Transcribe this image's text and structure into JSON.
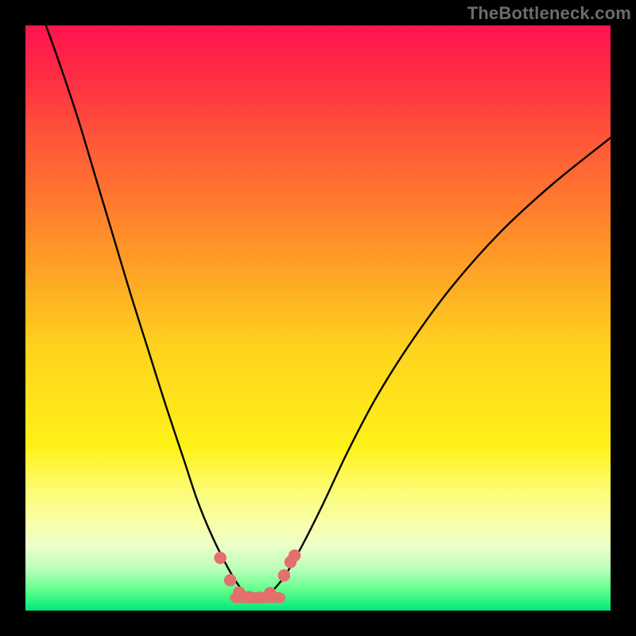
{
  "brand": {
    "watermark": "TheBottleneck.com"
  },
  "colors": {
    "marker": "#e46f6c",
    "curve": "#000000",
    "gradient_stops": [
      {
        "offset": 0.0,
        "color": "#ff1450"
      },
      {
        "offset": 0.08,
        "color": "#ff2a44"
      },
      {
        "offset": 0.2,
        "color": "#ff5838"
      },
      {
        "offset": 0.35,
        "color": "#ff8a2a"
      },
      {
        "offset": 0.55,
        "color": "#ffd21e"
      },
      {
        "offset": 0.72,
        "color": "#fff218"
      },
      {
        "offset": 0.8,
        "color": "#fdfc7a"
      },
      {
        "offset": 0.85,
        "color": "#f8ffa8"
      },
      {
        "offset": 0.89,
        "color": "#ecffca"
      },
      {
        "offset": 0.93,
        "color": "#b9ffba"
      },
      {
        "offset": 0.965,
        "color": "#5fff8a"
      },
      {
        "offset": 1.0,
        "color": "#00e87a"
      }
    ]
  },
  "chart_data": {
    "type": "line",
    "title": "",
    "xlabel": "",
    "ylabel": "",
    "xlim": [
      0,
      100
    ],
    "ylim": [
      0,
      100
    ],
    "grid": false,
    "legend": false,
    "series": [
      {
        "name": "bottleneck-curve",
        "x": [
          3.5,
          6,
          9,
          12,
          15,
          18,
          21,
          24,
          27,
          29.5,
          32,
          34.5,
          36.5,
          38,
          40,
          42,
          44.5,
          47.5,
          51,
          55,
          60,
          66,
          73,
          81,
          90,
          100
        ],
        "y": [
          100,
          93,
          84,
          74,
          64,
          54,
          44.5,
          35,
          26,
          18.5,
          12.5,
          7.5,
          4.2,
          2.6,
          2.3,
          3.2,
          6.2,
          11.5,
          18.5,
          27,
          36.5,
          46,
          55.5,
          64.5,
          72.8,
          80.8
        ]
      }
    ],
    "markers": [
      {
        "x": 33.3,
        "y": 9.0,
        "r": 1.05
      },
      {
        "x": 35.0,
        "y": 5.2,
        "r": 1.05
      },
      {
        "x": 36.5,
        "y": 3.1,
        "r": 1.05
      },
      {
        "x": 38.2,
        "y": 2.3,
        "r": 1.05
      },
      {
        "x": 40.0,
        "y": 2.2,
        "r": 1.05
      },
      {
        "x": 41.8,
        "y": 3.0,
        "r": 1.05
      },
      {
        "x": 44.2,
        "y": 6.0,
        "r": 1.05
      },
      {
        "x": 45.3,
        "y": 8.3,
        "r": 1.05
      },
      {
        "x": 46.0,
        "y": 9.4,
        "r": 1.05
      }
    ],
    "floor_band_y": 2.2
  }
}
